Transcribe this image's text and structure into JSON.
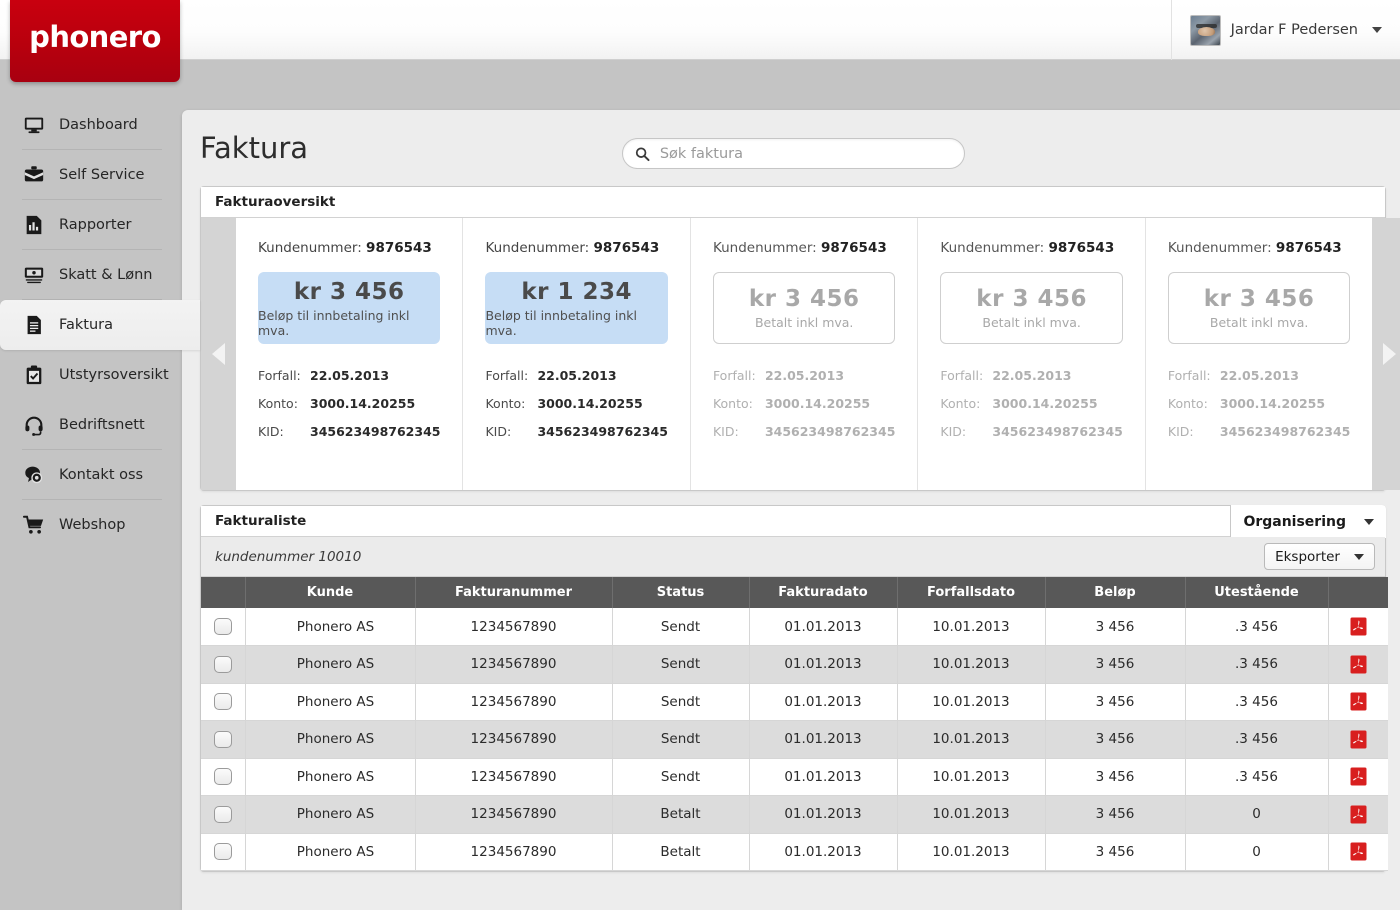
{
  "brand": {
    "name": "phonero",
    "color": "#c5000e"
  },
  "header": {
    "user_name": "Jardar F Pedersen",
    "avatar_icon": "user-avatar",
    "caret_icon": "chevron-down-icon"
  },
  "sidebar": {
    "items": [
      {
        "label": "Dashboard",
        "icon": "monitor-icon",
        "active": false
      },
      {
        "label": "Self Service",
        "icon": "briefcase-icon",
        "active": false
      },
      {
        "label": "Rapporter",
        "icon": "chart-doc-icon",
        "active": false
      },
      {
        "label": "Skatt & Lønn",
        "icon": "banknote-icon",
        "active": false
      },
      {
        "label": "Faktura",
        "icon": "document-icon",
        "active": true
      },
      {
        "label": "Utstyrsoversikt",
        "icon": "clipboard-check-icon",
        "active": false
      },
      {
        "label": "Bedriftsnett",
        "icon": "headset-icon",
        "active": false
      },
      {
        "label": "Kontakt oss",
        "icon": "chat-bubble-icon",
        "active": false
      },
      {
        "label": "Webshop",
        "icon": "shopping-cart-icon",
        "active": false
      }
    ]
  },
  "page": {
    "title": "Faktura",
    "search": {
      "placeholder": "Søk faktura",
      "value": "",
      "icon": "search-icon"
    }
  },
  "overview": {
    "panel_title": "Fakturaoversikt",
    "prev_arrow_icon": "chevron-left-icon",
    "next_arrow_icon": "chevron-right-icon",
    "labels": {
      "kundenummer": "Kundenummer:",
      "forfall": "Forfall:",
      "konto": "Konto:",
      "kid": "KID:"
    },
    "cards": [
      {
        "kundenummer": "9876543",
        "amount": "kr  3 456",
        "amount_label": "Beløp til innbetaling inkl mva.",
        "state": "active",
        "forfall": "22.05.2013",
        "konto": "3000.14.20255",
        "kid": "345623498762345"
      },
      {
        "kundenummer": "9876543",
        "amount": "kr 1 234",
        "amount_label": "Beløp til innbetaling inkl mva.",
        "state": "active",
        "forfall": "22.05.2013",
        "konto": "3000.14.20255",
        "kid": "345623498762345"
      },
      {
        "kundenummer": "9876543",
        "amount": "kr 3 456",
        "amount_label": "Betalt inkl mva.",
        "state": "paid",
        "forfall": "22.05.2013",
        "konto": "3000.14.20255",
        "kid": "345623498762345"
      },
      {
        "kundenummer": "9876543",
        "amount": "kr 3 456",
        "amount_label": "Betalt inkl mva.",
        "state": "paid",
        "forfall": "22.05.2013",
        "konto": "3000.14.20255",
        "kid": "345623498762345"
      },
      {
        "kundenummer": "9876543",
        "amount": "kr 3 456",
        "amount_label": "Betalt inkl mva.",
        "state": "paid",
        "forfall": "22.05.2013",
        "konto": "3000.14.20255",
        "kid": "345623498762345"
      }
    ]
  },
  "list": {
    "panel_title": "Fakturaliste",
    "organisering_label": "Organisering",
    "subtitle": "kundenummer 10010",
    "eksporter_label": "Eksporter",
    "columns": [
      "",
      "Kunde",
      "Fakturanummer",
      "Status",
      "Fakturadato",
      "Forfallsdato",
      "Beløp",
      "Utestående",
      ""
    ],
    "rows": [
      {
        "kunde": "Phonero AS",
        "fakturanummer": "1234567890",
        "status": "Sendt",
        "fakturadato": "01.01.2013",
        "forfallsdato": "10.01.2013",
        "belop": "3 456",
        "utestaende": ".3 456",
        "pdf_icon": "pdf-icon"
      },
      {
        "kunde": "Phonero AS",
        "fakturanummer": "1234567890",
        "status": "Sendt",
        "fakturadato": "01.01.2013",
        "forfallsdato": "10.01.2013",
        "belop": "3 456",
        "utestaende": ".3 456",
        "pdf_icon": "pdf-icon"
      },
      {
        "kunde": "Phonero AS",
        "fakturanummer": "1234567890",
        "status": "Sendt",
        "fakturadato": "01.01.2013",
        "forfallsdato": "10.01.2013",
        "belop": "3 456",
        "utestaende": ".3 456",
        "pdf_icon": "pdf-icon"
      },
      {
        "kunde": "Phonero AS",
        "fakturanummer": "1234567890",
        "status": "Sendt",
        "fakturadato": "01.01.2013",
        "forfallsdato": "10.01.2013",
        "belop": "3 456",
        "utestaende": ".3 456",
        "pdf_icon": "pdf-icon"
      },
      {
        "kunde": "Phonero AS",
        "fakturanummer": "1234567890",
        "status": "Sendt",
        "fakturadato": "01.01.2013",
        "forfallsdato": "10.01.2013",
        "belop": "3 456",
        "utestaende": ".3 456",
        "pdf_icon": "pdf-icon"
      },
      {
        "kunde": "Phonero AS",
        "fakturanummer": "1234567890",
        "status": "Betalt",
        "fakturadato": "01.01.2013",
        "forfallsdato": "10.01.2013",
        "belop": "3 456",
        "utestaende": "0",
        "pdf_icon": "pdf-icon"
      },
      {
        "kunde": "Phonero AS",
        "fakturanummer": "1234567890",
        "status": "Betalt",
        "fakturadato": "01.01.2013",
        "forfallsdato": "10.01.2013",
        "belop": "3 456",
        "utestaende": "0",
        "pdf_icon": "pdf-icon"
      }
    ]
  }
}
